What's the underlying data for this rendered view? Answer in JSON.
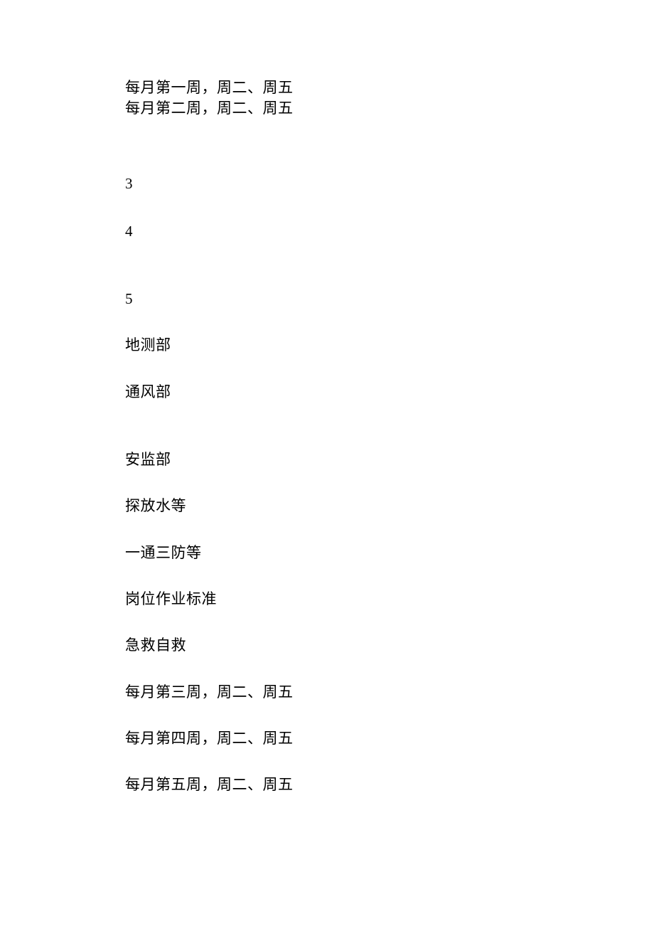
{
  "lines": {
    "l1": "每月第一周，周二、周五",
    "l2": "每月第二周，周二、周五",
    "l3": "3",
    "l4": "4",
    "l5": "5",
    "l6": "地测部",
    "l7": "通风部",
    "l8": "安监部",
    "l9": "探放水等",
    "l10": "一通三防等",
    "l11": "岗位作业标准",
    "l12": "急救自救",
    "l13": "每月第三周，周二、周五",
    "l14": "每月第四周，周二、周五",
    "l15": "每月第五周，周二、周五"
  }
}
